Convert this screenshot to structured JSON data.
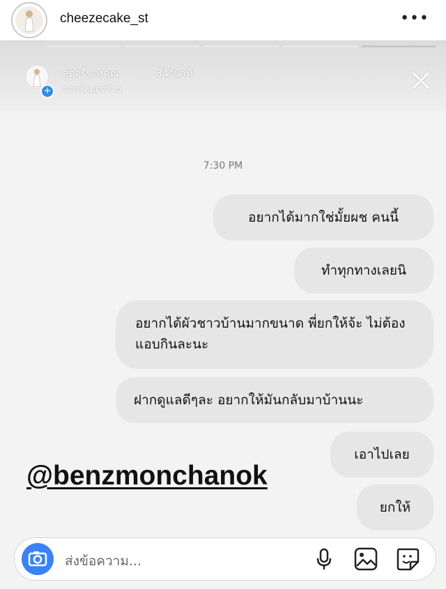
{
  "header": {
    "username": "cheezecake_st",
    "more_label": "•••"
  },
  "story": {
    "owner": "สตอรี่ของคุณ",
    "time": "34วินาที",
    "subtitle": "จากโหมดสร้าง"
  },
  "chat": {
    "timestamp": "7:30 PM",
    "messages": [
      "อยากได้มากใช่มั้ยผช คนนี้",
      "ทำทุกทางเลยนิ",
      "อยากได้ผัวชาวบ้านมากขนาด พี่ยกให้จ้ะ ไม่ต้องแอบกินละนะ",
      "ฝากดูแลดีๆละ อยากให้มันกลับมาบ้านนะ",
      "เอาไปเลย",
      "ยกให้"
    ],
    "mention": "@benzmonchanok"
  },
  "composer": {
    "placeholder": "ส่งข้อความ..."
  },
  "colors": {
    "bubble": "#e6e6e6",
    "camera_button": "#3b82f6",
    "background": "#f3f3f3"
  }
}
